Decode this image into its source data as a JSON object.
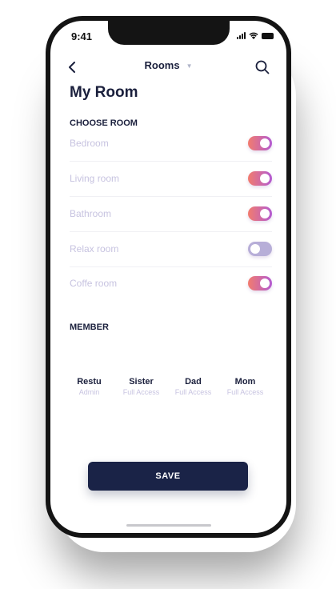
{
  "status_bar": {
    "time": "9:41"
  },
  "header": {
    "title": "Rooms"
  },
  "page": {
    "title": "My Room"
  },
  "rooms_section": {
    "label": "CHOOSE ROOM",
    "rooms": [
      {
        "name": "Bedroom",
        "enabled": true
      },
      {
        "name": "Living room",
        "enabled": true
      },
      {
        "name": "Bathroom",
        "enabled": true
      },
      {
        "name": "Relax room",
        "enabled": false
      },
      {
        "name": "Coffe room",
        "enabled": true
      }
    ]
  },
  "members_section": {
    "label": "MEMBER",
    "members": [
      {
        "name": "Restu",
        "access": "Admin"
      },
      {
        "name": "Sister",
        "access": "Full Access"
      },
      {
        "name": "Dad",
        "access": "Full Access"
      },
      {
        "name": "Mom",
        "access": "Full Access"
      }
    ]
  },
  "save_label": "SAVE",
  "colors": {
    "primary": "#1a2347",
    "toggle_on_start": "#f27c6e",
    "toggle_on_end": "#b35ad2",
    "toggle_off": "#b7aed8",
    "muted_text": "#c7c3e0"
  },
  "icons": [
    "back-arrow-icon",
    "caret-down-icon",
    "search-icon",
    "signal-icon",
    "wifi-icon",
    "battery-icon"
  ]
}
